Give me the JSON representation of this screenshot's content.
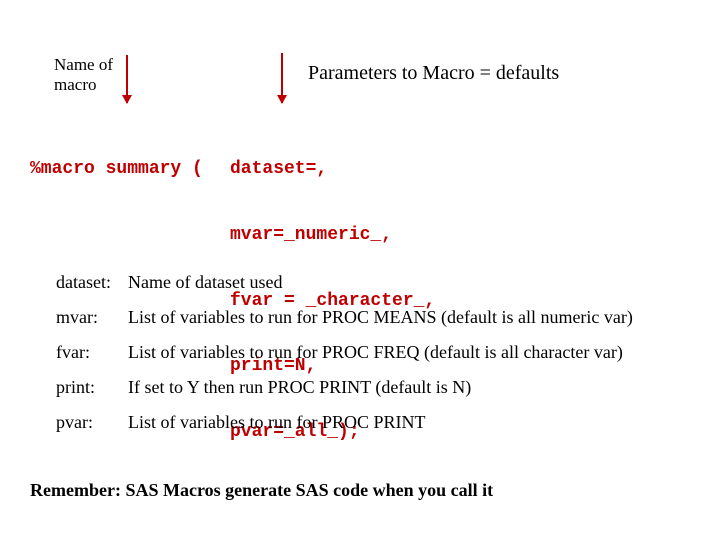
{
  "annotations": {
    "name_of_macro": "Name of macro",
    "params_defaults": "Parameters to Macro = defaults"
  },
  "code": {
    "head": "%macro summary (",
    "params": [
      "dataset=,",
      "mvar=_numeric_,",
      "fvar = _character_,",
      "print=N,",
      "pvar=_all_);"
    ]
  },
  "definitions": [
    {
      "term": "dataset:",
      "desc": "Name of dataset used"
    },
    {
      "term": "mvar:",
      "desc": "List of variables to run for PROC MEANS (default is all numeric var)"
    },
    {
      "term": "fvar:",
      "desc": "List of variables to run for PROC FREQ (default is all character var)"
    },
    {
      "term": "print:",
      "desc": "If set to Y then run PROC PRINT (default is N)"
    },
    {
      "term": "pvar:",
      "desc": "List of variables to run for PROC PRINT"
    }
  ],
  "footer": "Remember: SAS Macros generate SAS code when you call it"
}
